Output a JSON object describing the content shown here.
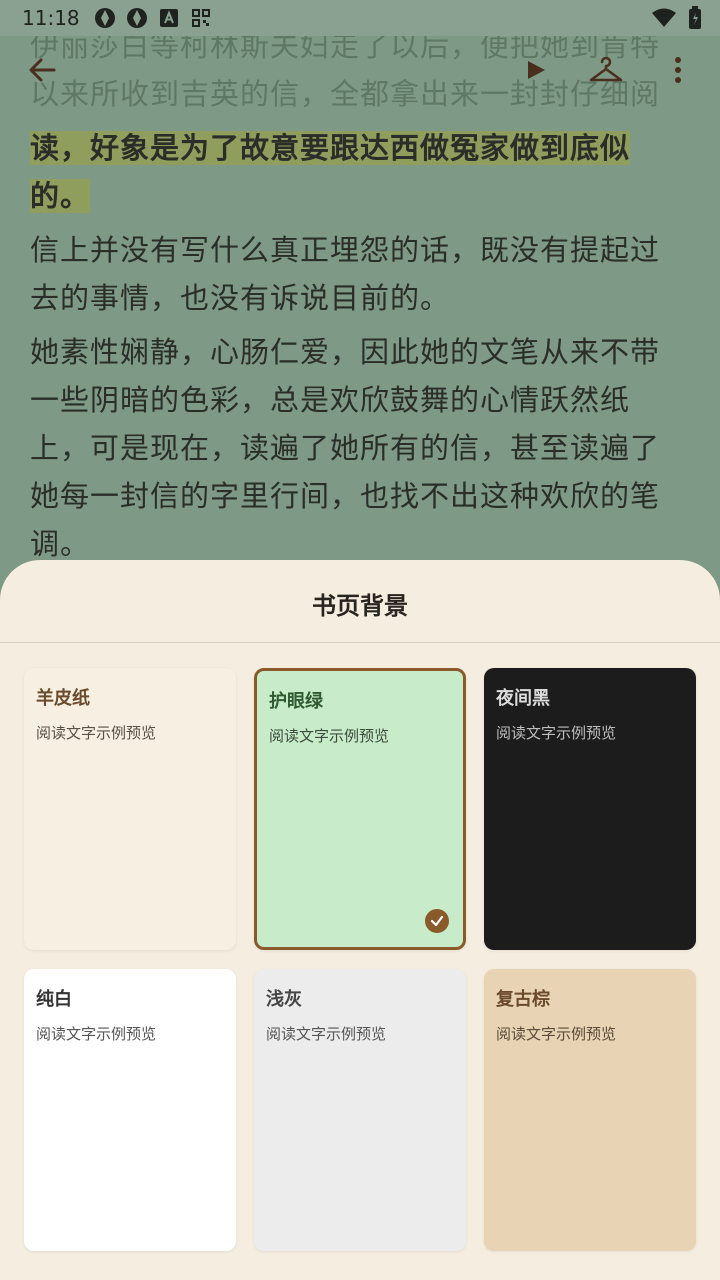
{
  "status": {
    "time": "11:18",
    "icons": [
      "aperture-icon",
      "aperture-icon",
      "app-a-icon",
      "qr-icon"
    ],
    "right_icons": [
      "wifi-icon",
      "battery-icon"
    ]
  },
  "reader": {
    "paragraphs": [
      {
        "text": "伊丽莎白等柯林斯夫妇走了以后，便把她到肯特以来所收到吉英的信，全都拿出来一封封仔细阅",
        "style": "faded"
      },
      {
        "text": "读，好象是为了故意要跟达西做冤家做到底似的。",
        "style": "highlight"
      },
      {
        "text": "信上并没有写什么真正埋怨的话，既没有提起过去的事情，也没有诉说目前的。",
        "style": "normal"
      },
      {
        "text": "她素性娴静，心肠仁爱，因此她的文笔从来不带一些阴暗的色彩，总是欢欣鼓舞的心情跃然纸上，可是现在，读遍了她所有的信，甚至读遍了她每一封信的字里行间，也找不出这种欢欣的笔调。",
        "style": "normal"
      }
    ]
  },
  "toolbar": {
    "back_icon": "arrow-left-icon",
    "play_icon": "play-icon",
    "theme_icon": "hanger-icon",
    "more_icon": "more-vert-icon"
  },
  "sheet": {
    "title": "书页背景",
    "options": [
      {
        "name": "羊皮纸",
        "preview": "阅读文字示例预览",
        "bg": "#f6efe2",
        "name_color": "#6a4a2a",
        "text_color": "#5a5048",
        "selected": false
      },
      {
        "name": "护眼绿",
        "preview": "阅读文字示例预览",
        "bg": "#c8ecca",
        "name_color": "#2f5a32",
        "text_color": "#3c4a3c",
        "selected": true
      },
      {
        "name": "夜间黑",
        "preview": "阅读文字示例预览",
        "bg": "#1c1c1c",
        "name_color": "#dcdcdc",
        "text_color": "#bdbdbd",
        "selected": false
      },
      {
        "name": "纯白",
        "preview": "阅读文字示例预览",
        "bg": "#ffffff",
        "name_color": "#333333",
        "text_color": "#555555",
        "selected": false
      },
      {
        "name": "浅灰",
        "preview": "阅读文字示例预览",
        "bg": "#ececec",
        "name_color": "#444444",
        "text_color": "#555555",
        "selected": false
      },
      {
        "name": "复古棕",
        "preview": "阅读文字示例预览",
        "bg": "#e8d4b4",
        "name_color": "#6a4a2a",
        "text_color": "#5a4a3a",
        "selected": false
      }
    ]
  },
  "colors": {
    "accent": "#8a5a2b",
    "sheet_bg": "#f5eee0",
    "reader_overlay": "#7e9a86"
  }
}
